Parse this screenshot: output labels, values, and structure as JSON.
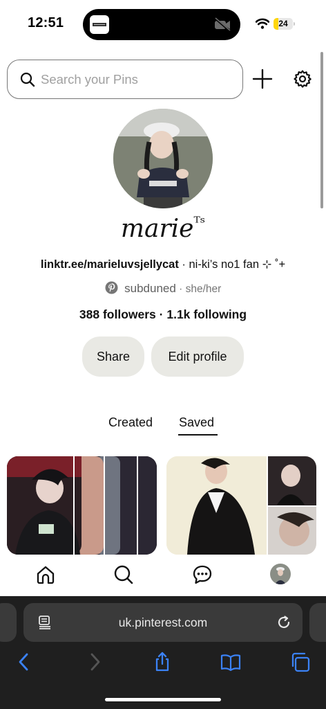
{
  "status_bar": {
    "time": "12:51",
    "battery_level": "24",
    "battery_fraction": 0.24,
    "battery_color": "#ffd60a"
  },
  "search": {
    "placeholder": "Search your Pins"
  },
  "icons": {
    "search": "search-icon",
    "add": "plus-icon",
    "settings": "gear-icon",
    "pinterest": "pinterest-logo-icon",
    "home": "home-icon",
    "explore": "search-icon",
    "messages": "chat-bubble-icon",
    "reader": "reader-mode-icon",
    "reload": "reload-icon",
    "back": "chevron-left-icon",
    "forward": "chevron-right-icon",
    "share": "share-icon",
    "bookmarks": "book-icon",
    "tabs": "tabs-icon"
  },
  "profile": {
    "display_name": "marie",
    "display_name_suffix": "ᵀˢ",
    "bio_link": "linktr.ee/marieluvsjellycat",
    "bio_text": " · ni-ki’s no1 fan ⊹ ˚+",
    "username": "subduned",
    "pronouns": " · she/her",
    "followers": "388 followers",
    "separator": " · ",
    "following": "1.1k following"
  },
  "actions": {
    "share": "Share",
    "edit_profile": "Edit profile"
  },
  "tabs": {
    "created": "Created",
    "saved": "Saved",
    "active": "Saved"
  },
  "browser": {
    "url": "uk.pinterest.com"
  },
  "colors": {
    "pill_bg": "#e9e9e4",
    "pinterest_red": "#767676",
    "safari_bar": "#1f1f1f",
    "accent_blue": "#3b82f6"
  }
}
